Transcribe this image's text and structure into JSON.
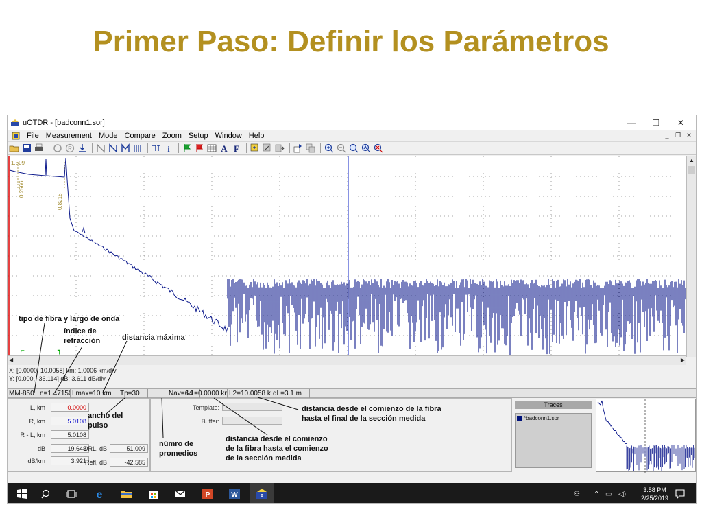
{
  "slide": {
    "title": "Primer Paso: Definir los Parámetros",
    "title_color": "#b39020"
  },
  "window": {
    "title": "uOTDR - [badconn1.sor]",
    "controls": [
      "minimize-icon",
      "restore-icon",
      "close-icon"
    ]
  },
  "menu": {
    "items": [
      "File",
      "Measurement",
      "Mode",
      "Compare",
      "Zoom",
      "Setup",
      "Window",
      "Help"
    ]
  },
  "toolbar": {
    "icons": [
      "open-folder-icon",
      "save-icon",
      "print-icon",
      "circle-icon",
      "registered-icon",
      "download-icon",
      "cursor-n-icon",
      "cursor-n2-icon",
      "cursor-n3-icon",
      "cursor-m-icon",
      "splice-icon",
      "info-icon",
      "flag-green-icon",
      "flag-red-icon",
      "table-icon",
      "font-a-icon",
      "font-f-icon",
      "event-add-icon",
      "event-edit-icon",
      "event-move-icon",
      "marker-in-icon",
      "marker-out-icon",
      "zoom-in-icon",
      "zoom-out-icon",
      "zoom-region-icon",
      "zoom-fit-icon",
      "zoom-reset-icon"
    ]
  },
  "trace": {
    "color": "#0d1a8c",
    "marker_label_1": "1.509",
    "marker_label_2": "0.2566",
    "marker_label_3": "0.8218"
  },
  "cursor_info": {
    "x_line": "X: [0.0000, 10.0058] km; 1.0006 km/div",
    "y_line": "Y: [0.000, -36.114] dB; 3.611 dB/div"
  },
  "status": {
    "fiber": "MM-850",
    "index": "n=1.47150",
    "lmax": "Lmax=10 km",
    "tp": "Tp=30",
    "nav": "Nav=64",
    "l1": "L1=0.0000 km",
    "l2": "L2=10.0058 km",
    "dl": "dL=3.1 m"
  },
  "params": {
    "l_label": "L, km",
    "l_value": "0.0000",
    "r_label": "R, km",
    "r_value": "5.0108",
    "rl_label": "R - L, km",
    "rl_value": "5.0108",
    "db_label": "dB",
    "db_value": "19.648",
    "dbdiv_label": "dB/km",
    "dbdiv_value": "3.921",
    "orl_label": "ORL, dB",
    "orl_value": "51.009",
    "refl_label": "Refl, dB",
    "refl_value": "-42.585"
  },
  "template_panel": {
    "template_label": "Template:",
    "buffer_label": "Buffer:"
  },
  "traces_panel": {
    "header": "Traces",
    "item": "*badconn1.sor"
  },
  "taskbar": {
    "icons": [
      "windows-start-icon",
      "search-icon",
      "task-view-icon",
      "edge-icon",
      "file-explorer-icon",
      "store-icon",
      "mail-icon",
      "powerpoint-icon",
      "word-icon",
      "uotdr-app-icon"
    ],
    "time": "3:58 PM",
    "date": "2/25/2019"
  },
  "annotations": {
    "fiber_type": "tipo de fibra y largo de onda",
    "refraction_1": "índice de",
    "refraction_2": "refracción",
    "max_distance": "distancia máxima",
    "pulse_1": "ancho del",
    "pulse_2": "pulso",
    "averages_1": "númro de",
    "averages_2": "promedios",
    "start_1": "distancia desde el comienzo",
    "start_2": "de la fibra hasta el comienzo",
    "start_3": "de la sección medida",
    "end_1": "distancia desde el comienzo de la fibra",
    "end_2": "hasta el final de la sección medida"
  }
}
